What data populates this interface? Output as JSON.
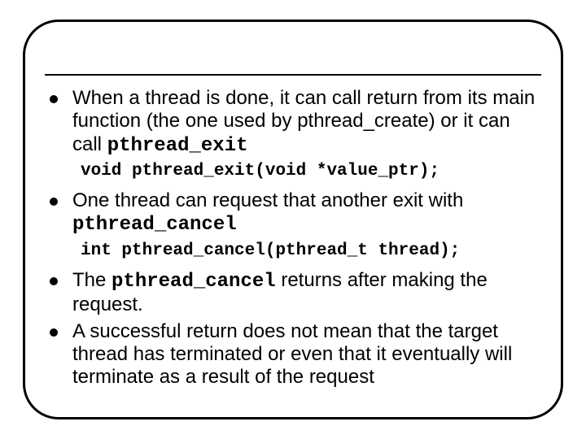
{
  "bullets": {
    "b1_pre": "When a thread is done, it can call return from its main function (the one used by pthread_create) or it can call ",
    "b1_code": "pthread_exit",
    "code1": "void pthread_exit(void *value_ptr);",
    "b2_pre": "One thread can request that another exit with ",
    "b2_code": "pthread_cancel",
    "code2": "int pthread_cancel(pthread_t thread);",
    "b3_pre": "The ",
    "b3_code": "pthread_cancel",
    "b3_post": " returns after making the request.",
    "b4": "A successful return does not mean that the target thread has terminated or even that it eventually will terminate as a result of the request"
  }
}
